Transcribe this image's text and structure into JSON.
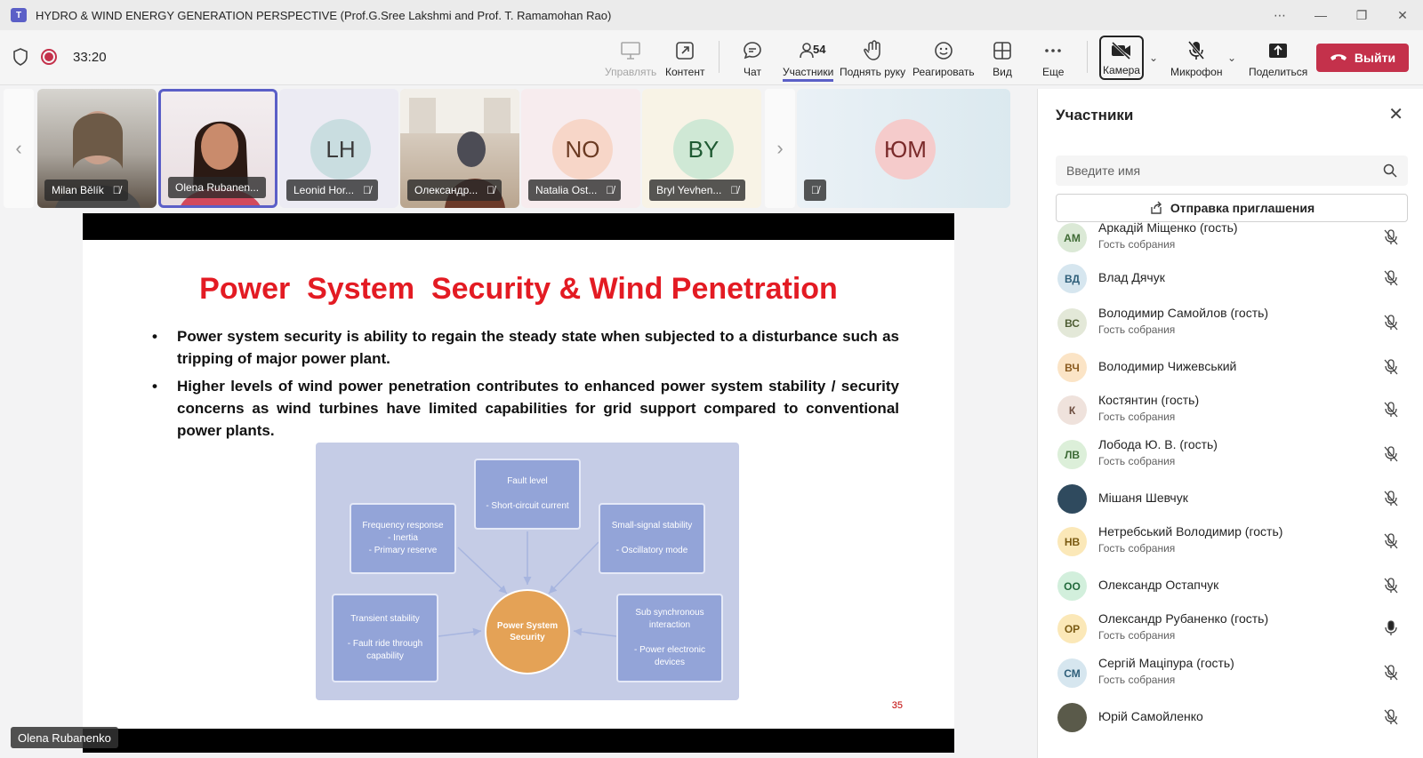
{
  "window": {
    "title": "HYDRO & WIND ENERGY GENERATION PERSPECTIVE (Prof.G.Sree Lakshmi and Prof. T. Ramamohan Rao)",
    "app_icon": "T",
    "controls": [
      "⋯",
      "—",
      "❐",
      "✕"
    ]
  },
  "toolbar": {
    "timer": "33:20",
    "manage": "Управлять",
    "content": "Контент",
    "chat": "Чат",
    "participants": "Участники",
    "participants_count": "54",
    "raise_hand": "Поднять руку",
    "react": "Реагировать",
    "view": "Вид",
    "more": "Еще",
    "camera": "Камера",
    "mic": "Микрофон",
    "share": "Поделиться",
    "leave": "Выйти"
  },
  "tiles": [
    {
      "name": "Milan Bělík",
      "initials": "",
      "bg": "#8a8a8a"
    },
    {
      "name": "Olena Rubanen...",
      "initials": "",
      "bg": "#e9d9df"
    },
    {
      "name": "Leonid Hor...",
      "initials": "LH",
      "bg": "#c9dde0"
    },
    {
      "name": "Олександр...",
      "initials": "",
      "bg": "#8d7a6a"
    },
    {
      "name": "Natalia Ost...",
      "initials": "NO",
      "bg": "#f7d6c8"
    },
    {
      "name": "Bryl Yevhen...",
      "initials": "BY",
      "bg": "#cfe8d5"
    },
    {
      "name": "",
      "initials": "ЮМ",
      "bg": "#f5cbcb"
    }
  ],
  "slide": {
    "title": "Power  System  Security & Wind Penetration",
    "bullets": [
      "Power system security is ability to regain the steady state when subjected to a disturbance such as tripping of major power plant.",
      "Higher levels of wind power penetration contributes to enhanced power system stability / security concerns as wind turbines have limited capabilities for grid support compared to conventional power plants."
    ],
    "diagram": {
      "center": "Power System Security",
      "fault": {
        "title": "Fault level",
        "items": "- Short-circuit current"
      },
      "freq": {
        "title": "Frequency response",
        "items": "- Inertia\n- Primary reserve"
      },
      "small": {
        "title": "Small-signal stability",
        "items": "- Oscillatory mode"
      },
      "transient": {
        "title": "Transient stability",
        "items": "- Fault ride through capability"
      },
      "subsync": {
        "title": "Sub synchronous interaction",
        "items": "- Power electronic devices"
      }
    },
    "page_number": "35"
  },
  "speaker_name": "Olena Rubanenko",
  "panel": {
    "title": "Участники",
    "search_placeholder": "Введите имя",
    "invite": "Отправка приглашения",
    "participants": [
      {
        "initials": "АМ",
        "name": "Аркадій Міщенко (гость)",
        "role": "Гость собрания",
        "bg": "#dbe9d6",
        "fg": "#3f6b35",
        "mic_on": false
      },
      {
        "initials": "ВД",
        "name": "Влад Дячук",
        "role": "",
        "bg": "#d6e6ef",
        "fg": "#2e5f7a",
        "mic_on": false
      },
      {
        "initials": "ВС",
        "name": "Володимир Самойлов (гость)",
        "role": "Гость собрания",
        "bg": "#e3e8d8",
        "fg": "#4f5e34",
        "mic_on": false
      },
      {
        "initials": "ВЧ",
        "name": "Володимир Чижевський",
        "role": "",
        "bg": "#fbe4c6",
        "fg": "#8a5a1f",
        "mic_on": false
      },
      {
        "initials": "К",
        "name": "Костянтин (гость)",
        "role": "Гость собрания",
        "bg": "#efe2dc",
        "fg": "#6a4a3c",
        "mic_on": false
      },
      {
        "initials": "ЛВ",
        "name": "Лобода Ю. В. (гость)",
        "role": "Гость собрания",
        "bg": "#dcefd9",
        "fg": "#3c6a35",
        "mic_on": false
      },
      {
        "initials": "",
        "name": "Мішаня Шевчук",
        "role": "",
        "bg": "#2f4a5e",
        "fg": "#ffffff",
        "mic_on": false
      },
      {
        "initials": "НВ",
        "name": "Нетребський Володимир (гость)",
        "role": "Гость собрания",
        "bg": "#fbe8b8",
        "fg": "#7a5a12",
        "mic_on": false
      },
      {
        "initials": "ОО",
        "name": "Олександр Остапчук",
        "role": "",
        "bg": "#d2efdc",
        "fg": "#226a3c",
        "mic_on": false
      },
      {
        "initials": "ОР",
        "name": "Олександр Рубаненко (гость)",
        "role": "Гость собрания",
        "bg": "#fbe8b8",
        "fg": "#7a5a12",
        "mic_on": true
      },
      {
        "initials": "СМ",
        "name": "Сергій Маціпура (гость)",
        "role": "Гость собрания",
        "bg": "#d6e6ef",
        "fg": "#2e5f7a",
        "mic_on": false
      },
      {
        "initials": "",
        "name": "Юрій Самойленко",
        "role": "",
        "bg": "#5a5a4a",
        "fg": "#ffffff",
        "mic_on": false
      }
    ]
  }
}
